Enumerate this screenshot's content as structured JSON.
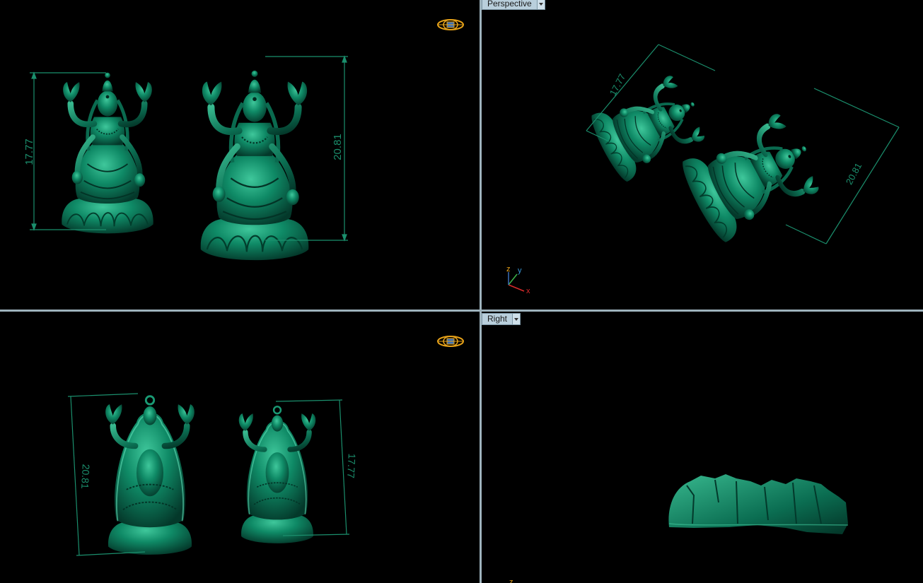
{
  "viewports": {
    "top": {
      "dimension_left": "17.77",
      "dimension_right": "20.81"
    },
    "perspective": {
      "label": "Perspective",
      "dimension_left": "17.77",
      "dimension_right": "20.81",
      "axis": {
        "z": "z",
        "y": "y",
        "x": "x"
      }
    },
    "front": {
      "dimension_left": "20.81",
      "dimension_right": "17.77"
    },
    "right": {
      "label": "Right",
      "axis": {
        "z": "z"
      }
    }
  },
  "colors": {
    "model": "#0d7a5e",
    "dimension_line": "#1b8f6d",
    "viewport_bg": "#000000",
    "splitter": "#9eb3bd",
    "tab_bg": "#b9cfdc",
    "gumball": "#e8a319"
  },
  "icons": {
    "view_cube": "view-cube-icon",
    "dropdown": "chevron-down-icon"
  }
}
